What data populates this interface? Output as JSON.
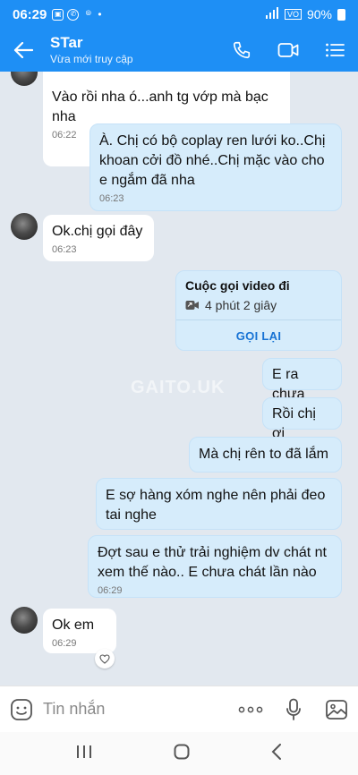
{
  "status": {
    "time": "06:29",
    "battery": "90%"
  },
  "header": {
    "title": "STar",
    "subtitle": "Vừa mới truy cập"
  },
  "messages": [
    {
      "text": "Vào rồi nha ó...anh tg vớp mà bạc\nnha",
      "time": "06:22"
    },
    {
      "text": "À. Chị có bộ coplay ren lưới ko..Chị khoan cởi đồ nhé..Chị mặc vào cho e ngắm đã nha",
      "time": "06:23"
    },
    {
      "text": "Ok.chị gọi đây",
      "time": "06:23"
    },
    {
      "text": "E ra chưa"
    },
    {
      "text": "Rồi chị ơi"
    },
    {
      "text": "Mà chị rên to đã lắm"
    },
    {
      "text": "E sợ hàng xóm nghe nên phải đeo tai nghe"
    },
    {
      "text": "Đợt sau e thử trải nghiệm dv chát nt xem thế nào.. E chưa chát lần nào",
      "time": "06:29"
    },
    {
      "text": "Ok em",
      "time": "06:29"
    }
  ],
  "call": {
    "title": "Cuộc gọi video đi",
    "duration": "4 phút 2 giây",
    "button": "GỌI LẠI"
  },
  "watermark": "GAITO.UK",
  "input": {
    "placeholder": "Tin nhắn"
  }
}
